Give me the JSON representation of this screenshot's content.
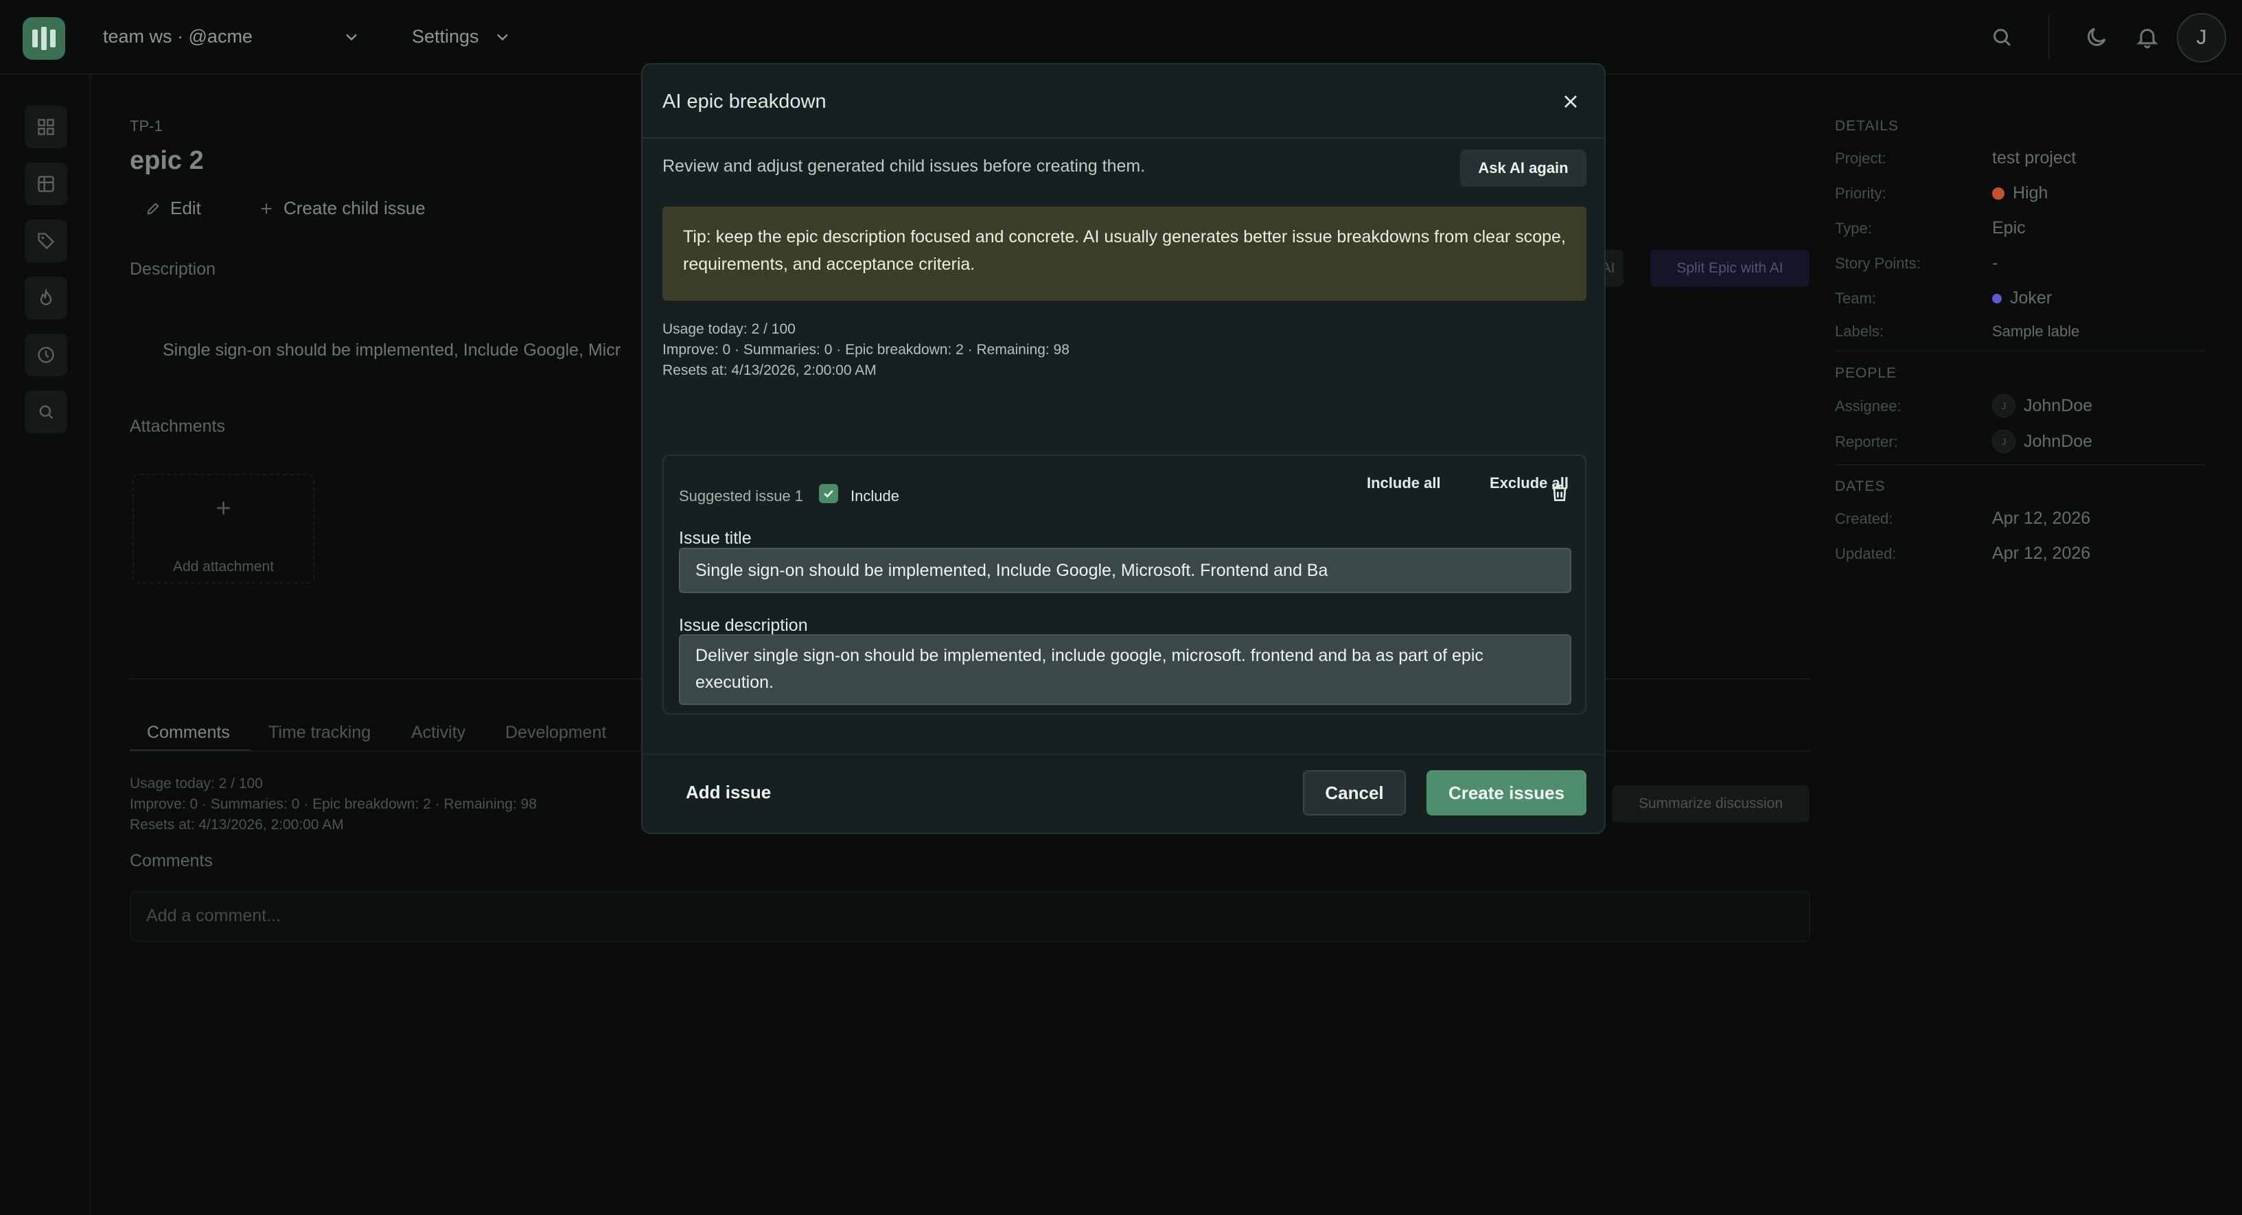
{
  "topbar": {
    "workspace": "team ws · @acme",
    "settings": "Settings",
    "avatar_initial": "J"
  },
  "issue": {
    "key": "TP-1",
    "title": "epic 2",
    "edit_label": "Edit",
    "create_child_label": "Create child issue",
    "description_label": "Description",
    "description_text": "Single sign-on should be implemented, Include Google, Micr",
    "attachments_label": "Attachments",
    "add_attachment_label": "Add attachment",
    "ai_button_partial": "AI",
    "split_epic_button": "Split Epic with AI"
  },
  "tabs": [
    "Comments",
    "Time tracking",
    "Activity",
    "Development"
  ],
  "usage": {
    "line1": "Usage today: 2 / 100",
    "line2": "Improve: 0 · Summaries: 0 · Epic breakdown: 2 · Remaining: 98",
    "line3": "Resets at: 4/13/2026, 2:00:00 AM"
  },
  "comments": {
    "label": "Comments",
    "placeholder": "Add a comment...",
    "summarize_button": "Summarize discussion"
  },
  "details": {
    "heading": "DETAILS",
    "rows": [
      {
        "key": "Project:",
        "value": "test project"
      },
      {
        "key": "Priority:",
        "value": "High"
      },
      {
        "key": "Type:",
        "value": "Epic"
      },
      {
        "key": "Story Points:",
        "value": "-"
      },
      {
        "key": "Team:",
        "value": "Joker"
      },
      {
        "key": "Labels:",
        "value": "Sample lable"
      }
    ],
    "priority_color": "#c2522d",
    "team_color": "#5b5bd6",
    "people_heading": "PEOPLE",
    "people": [
      {
        "key": "Assignee:",
        "value": "JohnDoe",
        "initial": "J"
      },
      {
        "key": "Reporter:",
        "value": "JohnDoe",
        "initial": "J"
      }
    ],
    "dates_heading": "DATES",
    "dates": [
      {
        "key": "Created:",
        "value": "Apr 12, 2026"
      },
      {
        "key": "Updated:",
        "value": "Apr 12, 2026"
      }
    ]
  },
  "modal": {
    "title": "AI epic breakdown",
    "subtitle": "Review and adjust generated child issues before creating them.",
    "ask_again": "Ask AI again",
    "tip": "Tip: keep the epic description focused and concrete. AI usually generates better issue breakdowns from clear scope, requirements, and acceptance criteria.",
    "include_all": "Include all",
    "exclude_all": "Exclude all",
    "suggestion": {
      "label": "Suggested issue 1",
      "include_label": "Include",
      "included": true,
      "title_label": "Issue title",
      "title_value": "Single sign-on should be implemented, Include Google, Microsoft. Frontend and Ba",
      "description_label": "Issue description",
      "description_value": "Deliver single sign-on should be implemented, include google, microsoft. frontend and ba as part of epic execution."
    },
    "add_issue": "Add issue",
    "cancel": "Cancel",
    "create": "Create issues"
  },
  "colors": {
    "accent": "#4f8e6d",
    "tip_bg": "#3d3e29",
    "modal_bg": "#172020"
  }
}
